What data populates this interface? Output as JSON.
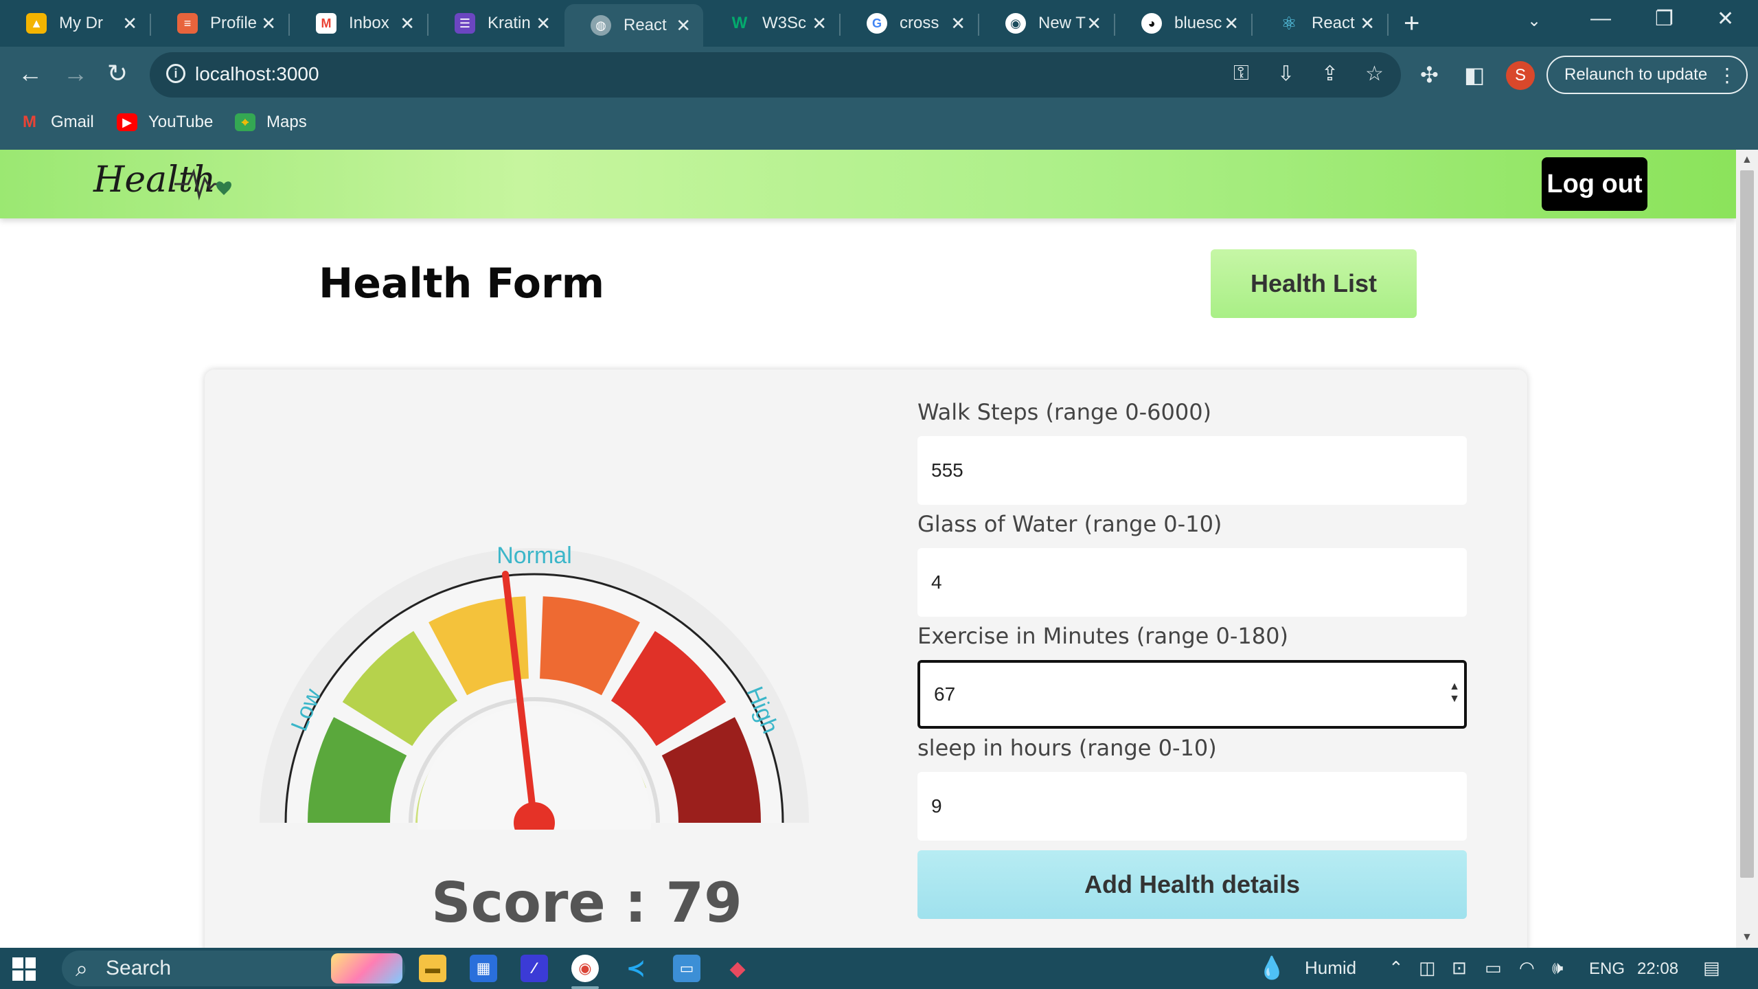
{
  "browser": {
    "tabs": [
      {
        "title": "My Dr",
        "icon": "google-drive-icon",
        "color": "#f4b400"
      },
      {
        "title": "Profile",
        "icon": "profile-icon",
        "color": "#e8643c"
      },
      {
        "title": "Inbox",
        "icon": "gmail-icon",
        "color": "#ea4335"
      },
      {
        "title": "Kratin",
        "icon": "kratin-icon",
        "color": "#6b46c1"
      },
      {
        "title": "React",
        "icon": "globe-icon",
        "color": "#8aa4ad"
      },
      {
        "title": "W3Sc",
        "icon": "w3schools-icon",
        "color": "#04aa6d"
      },
      {
        "title": "cross",
        "icon": "google-icon",
        "color": "#ffffff"
      },
      {
        "title": "New T",
        "icon": "chrome-icon",
        "color": "#ffffff"
      },
      {
        "title": "bluesc",
        "icon": "github-icon",
        "color": "#ffffff"
      },
      {
        "title": "React",
        "icon": "react-icon",
        "color": "#61dafb"
      }
    ],
    "url": "localhost:3000",
    "relaunch_label": "Relaunch to update",
    "profile_initial": "S",
    "bookmarks": [
      {
        "label": "Gmail",
        "icon": "gmail-icon"
      },
      {
        "label": "YouTube",
        "icon": "youtube-icon"
      },
      {
        "label": "Maps",
        "icon": "maps-icon"
      }
    ]
  },
  "app": {
    "logout_label": "Log out",
    "form_title": "Health Form",
    "health_list_label": "Health List",
    "gauge": {
      "labels": {
        "low": "Low",
        "normal": "Normal",
        "high": "High"
      },
      "colors": [
        "#5aa83c",
        "#b6d24c",
        "#f4c23b",
        "#ee6a32",
        "#e03128",
        "#9b1f1c"
      ],
      "needle_color": "#e53227"
    },
    "score_text": "Score : 79",
    "fields": [
      {
        "label": "Walk Steps (range 0-6000)",
        "value": "555"
      },
      {
        "label": "Glass of Water (range 0-10)",
        "value": "4"
      },
      {
        "label": "Exercise in Minutes (range 0-180)",
        "value": "67"
      },
      {
        "label": "sleep in hours (range 0-10)",
        "value": "9"
      }
    ],
    "submit_label": "Add Health details"
  },
  "taskbar": {
    "search_label": "Search",
    "weather_label": "Humid",
    "language": "ENG",
    "time": "22:08"
  }
}
